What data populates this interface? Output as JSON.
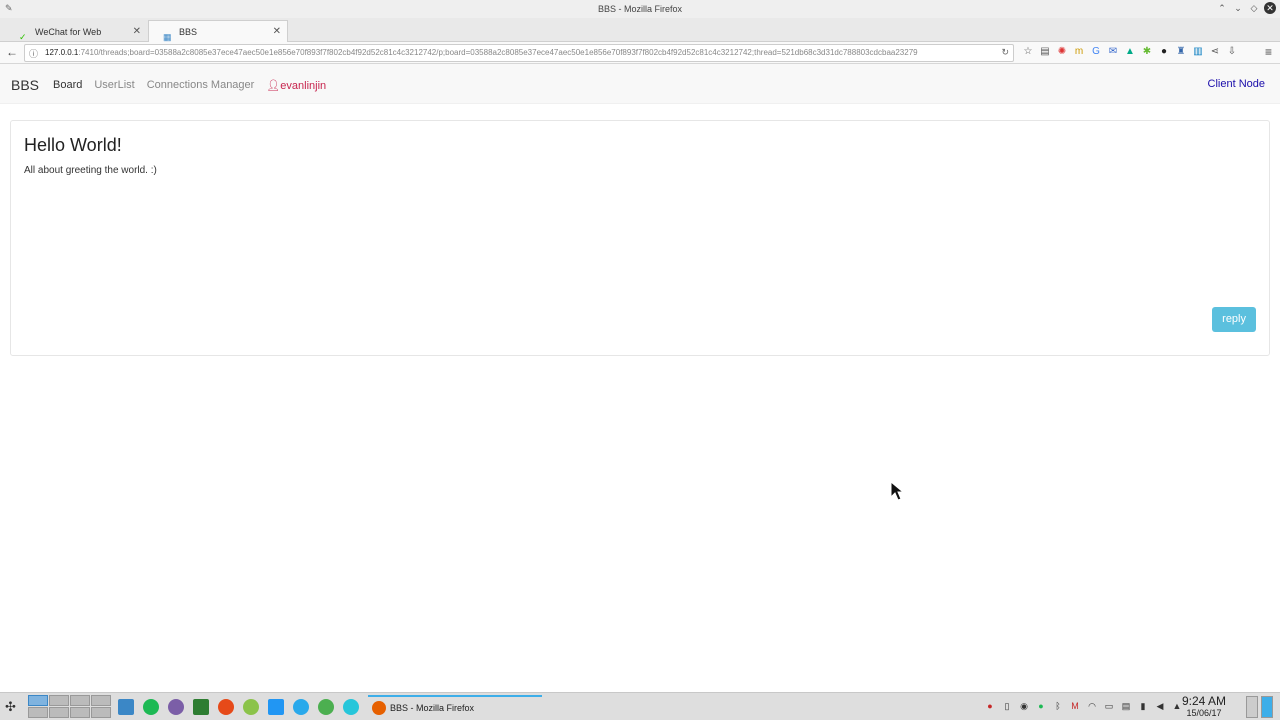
{
  "window": {
    "title": "BBS - Mozilla Firefox"
  },
  "tabs": [
    {
      "label": "WeChat for Web",
      "active": false
    },
    {
      "label": "BBS",
      "active": true
    }
  ],
  "address_bar": {
    "host": "127.0.0.1",
    "rest": ":7410/threads;board=03588a2c8085e37ece47aec50e1e856e70f893f7f802cb4f92d52c81c4c3212742/p;board=03588a2c8085e37ece47aec50e1e856e70f893f7f802cb4f92d52c81c4c3212742;thread=521db68c3d31dc788803cdcbaa23279"
  },
  "app_nav": {
    "brand": "BBS",
    "items": [
      {
        "label": "Board",
        "active": true
      },
      {
        "label": "UserList",
        "active": false
      },
      {
        "label": "Connections Manager",
        "active": false
      }
    ],
    "user": "evanlinjin",
    "right_link": "Client Node"
  },
  "thread": {
    "title": "Hello World!",
    "body": "All about greeting the world. :)",
    "reply_label": "reply"
  },
  "taskbar": {
    "task_label": "BBS - Mozilla Firefox",
    "time": "9:24 AM",
    "date": "15/06/17"
  },
  "colors": {
    "reply_button": "#5bc0de",
    "user_link": "#c7254e",
    "client_node_link": "#1a0dab"
  }
}
